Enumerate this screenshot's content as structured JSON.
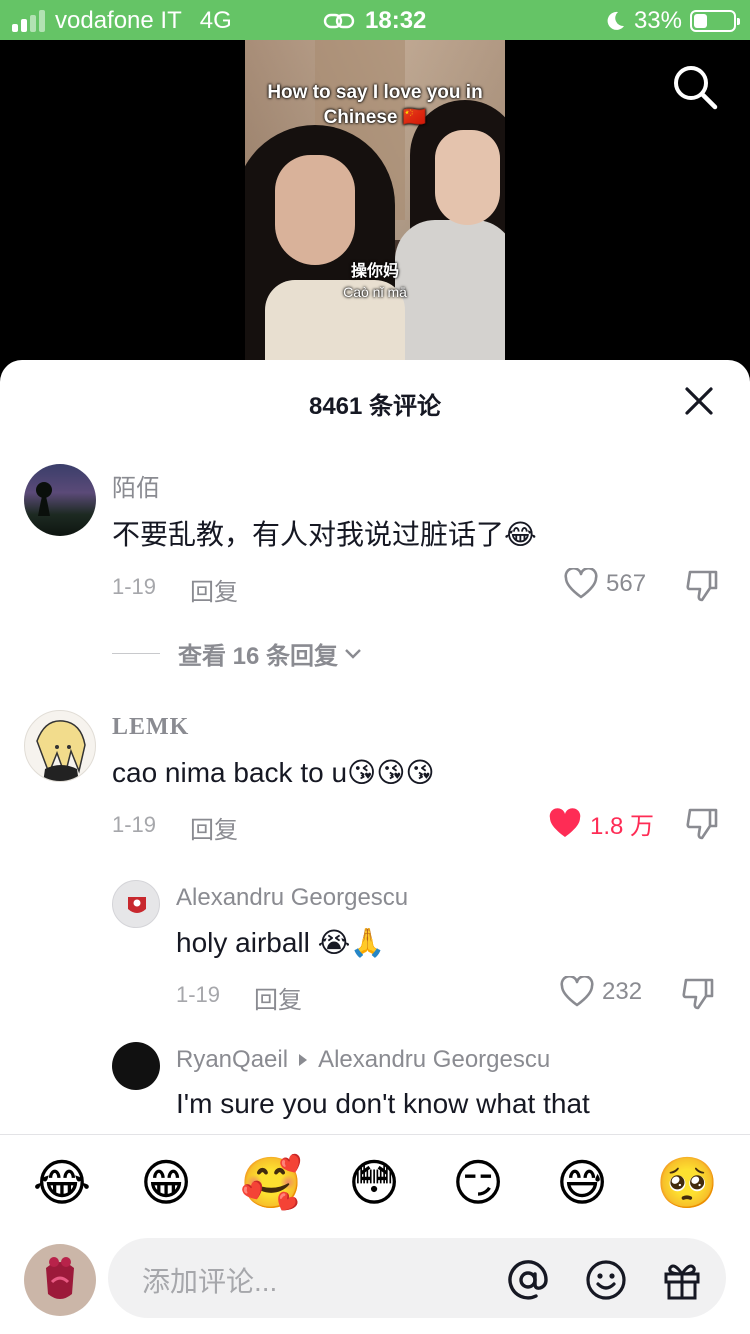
{
  "status": {
    "carrier": "vodafone IT",
    "network": "4G",
    "time": "18:32",
    "battery": "33%",
    "battery_level": 0.33,
    "accent": "#65c466"
  },
  "video": {
    "caption_top": "How to say I love you in Chinese 🇨🇳",
    "caption_hanzi": "操你妈",
    "caption_pinyin": "Caò nǐ mā"
  },
  "sheet": {
    "title": "8461 条评论"
  },
  "comments": [
    {
      "user": "陌佰",
      "text": "不要乱教，有人对我说过脏话了😂",
      "date": "1-19",
      "reply_label": "回复",
      "likes": "567",
      "view_replies": "查看 16 条回复"
    },
    {
      "user": "LEMK",
      "text": "cao nima back to u😘😘😘",
      "date": "1-19",
      "reply_label": "回复",
      "likes": "1.8 万"
    }
  ],
  "replies": [
    {
      "user": "Alexandru Georgescu",
      "text": "holy airball 😭🙏",
      "date": "1-19",
      "reply_label": "回复",
      "likes": "232"
    },
    {
      "user": "RyanQaeil",
      "reply_to": "Alexandru Georgescu",
      "text": "I'm sure you don't know what that"
    }
  ],
  "emoji_bar": [
    "😂",
    "😁",
    "🥰",
    "😳",
    "😏",
    "😅",
    "🥺"
  ],
  "input": {
    "placeholder": "添加评论..."
  },
  "colors": {
    "like_red": "#fe2c55",
    "muted": "#8a8b91"
  }
}
